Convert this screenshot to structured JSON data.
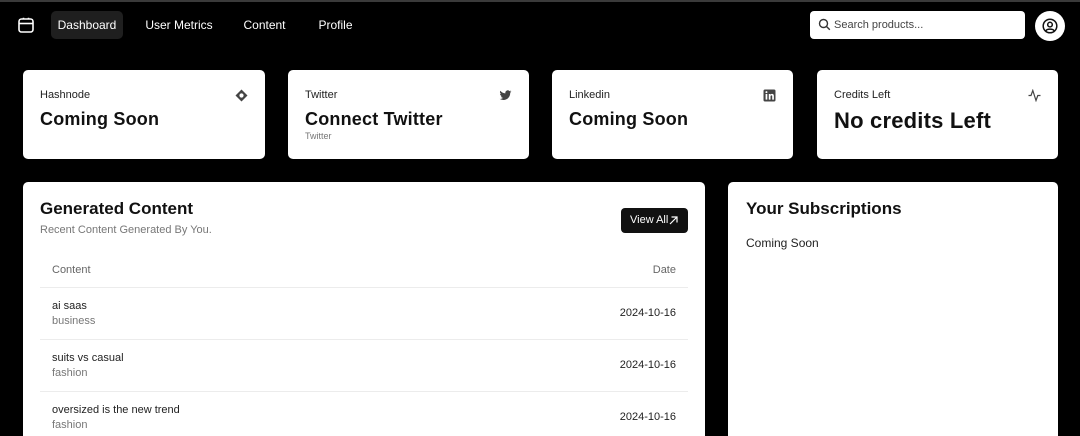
{
  "nav": {
    "items": [
      {
        "label": "Dashboard",
        "active": true
      },
      {
        "label": "User Metrics",
        "active": false
      },
      {
        "label": "Content",
        "active": false
      },
      {
        "label": "Profile",
        "active": false
      }
    ],
    "search_placeholder": "Search products..."
  },
  "cards": [
    {
      "label": "Hashnode",
      "value": "Coming Soon",
      "sub": "",
      "icon": "hashnode-icon"
    },
    {
      "label": "Twitter",
      "value": "Connect Twitter",
      "sub": "Twitter",
      "icon": "twitter-icon"
    },
    {
      "label": "Linkedin",
      "value": "Coming Soon",
      "sub": "",
      "icon": "linkedin-icon"
    },
    {
      "label": "Credits Left",
      "value": "No credits Left",
      "sub": "",
      "icon": "activity-icon"
    }
  ],
  "generated": {
    "title": "Generated Content",
    "subtitle": "Recent Content Generated By You.",
    "view_all": "View All",
    "columns": {
      "content": "Content",
      "date": "Date"
    },
    "rows": [
      {
        "title": "ai saas",
        "category": "business",
        "date": "2024-10-16"
      },
      {
        "title": "suits vs casual",
        "category": "fashion",
        "date": "2024-10-16"
      },
      {
        "title": "oversized is the new trend",
        "category": "fashion",
        "date": "2024-10-16"
      }
    ]
  },
  "subscriptions": {
    "title": "Your Subscriptions",
    "text": "Coming Soon"
  },
  "colors": {
    "background": "#000000",
    "card": "#ffffff",
    "button_dark": "#111111",
    "nav_active": "#1f1f1f"
  }
}
